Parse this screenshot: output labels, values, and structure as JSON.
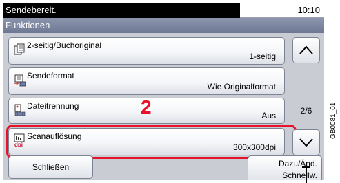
{
  "status": {
    "message": "Sendebereit.",
    "time": "10:10"
  },
  "section": {
    "title": "Funktionen"
  },
  "items": [
    {
      "label": "2-seitig/Buchoriginal",
      "value": "1-seitig"
    },
    {
      "label": "Sendeformat",
      "value": "Wie Originalformat"
    },
    {
      "label": "Dateitrennung",
      "value": "Aus"
    },
    {
      "label": "Scanauflösung",
      "value": "300x300dpi"
    }
  ],
  "pagination": {
    "indicator": "2/6"
  },
  "annotation": {
    "step": "2"
  },
  "buttons": {
    "close": "Schließen",
    "add_line1": "Dazu/Änd.",
    "add_line2": "Schnellw."
  },
  "document_id": "GB0081_01"
}
